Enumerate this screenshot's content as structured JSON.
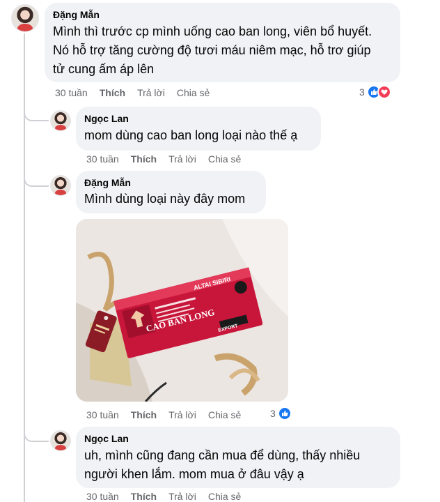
{
  "comments": [
    {
      "author": "Đặng Mẫn",
      "text": "Mình thì trước cp mình uống cao ban long, viên bổ huyết.\nNó hỗ trợ tăng cường độ tươi máu niêm mạc, hỗ trơ giúp\ntử cung ấm áp lên",
      "time": "30 tuần",
      "like": "Thích",
      "reply": "Trả lời",
      "share": "Chia sẻ",
      "reactions": "3"
    },
    {
      "author": "Ngọc Lan",
      "text": "mom dùng cao ban long loại nào thế ạ",
      "time": "30 tuần",
      "like": "Thích",
      "reply": "Trả lời",
      "share": "Chia sẻ"
    },
    {
      "author": "Đặng Mẫn",
      "text": "Mình dùng loại này đây mom",
      "time": "30 tuần",
      "like": "Thích",
      "reply": "Trả lời",
      "share": "Chia sẻ",
      "reactions": "3",
      "photo": {
        "product_name": "CAO BAN LONG",
        "brand": "ALTAI SIBIRI",
        "badge": "EXPORT"
      }
    },
    {
      "author": "Ngọc Lan",
      "text": "uh, mình cũng đang cần mua để dùng, thấy nhiều\nngười khen lắm. mom mua ở đâu vậy ạ",
      "time": "30 tuần",
      "like": "Thích",
      "reply": "Trả lời",
      "share": "Chia sẻ"
    }
  ],
  "icons": {
    "like_reaction": "thumbs-up-icon",
    "love_reaction": "heart-icon"
  },
  "colors": {
    "like": "#1877f2",
    "love": "#f33e58",
    "bubble": "#f0f2f5",
    "meta": "#65676b"
  }
}
